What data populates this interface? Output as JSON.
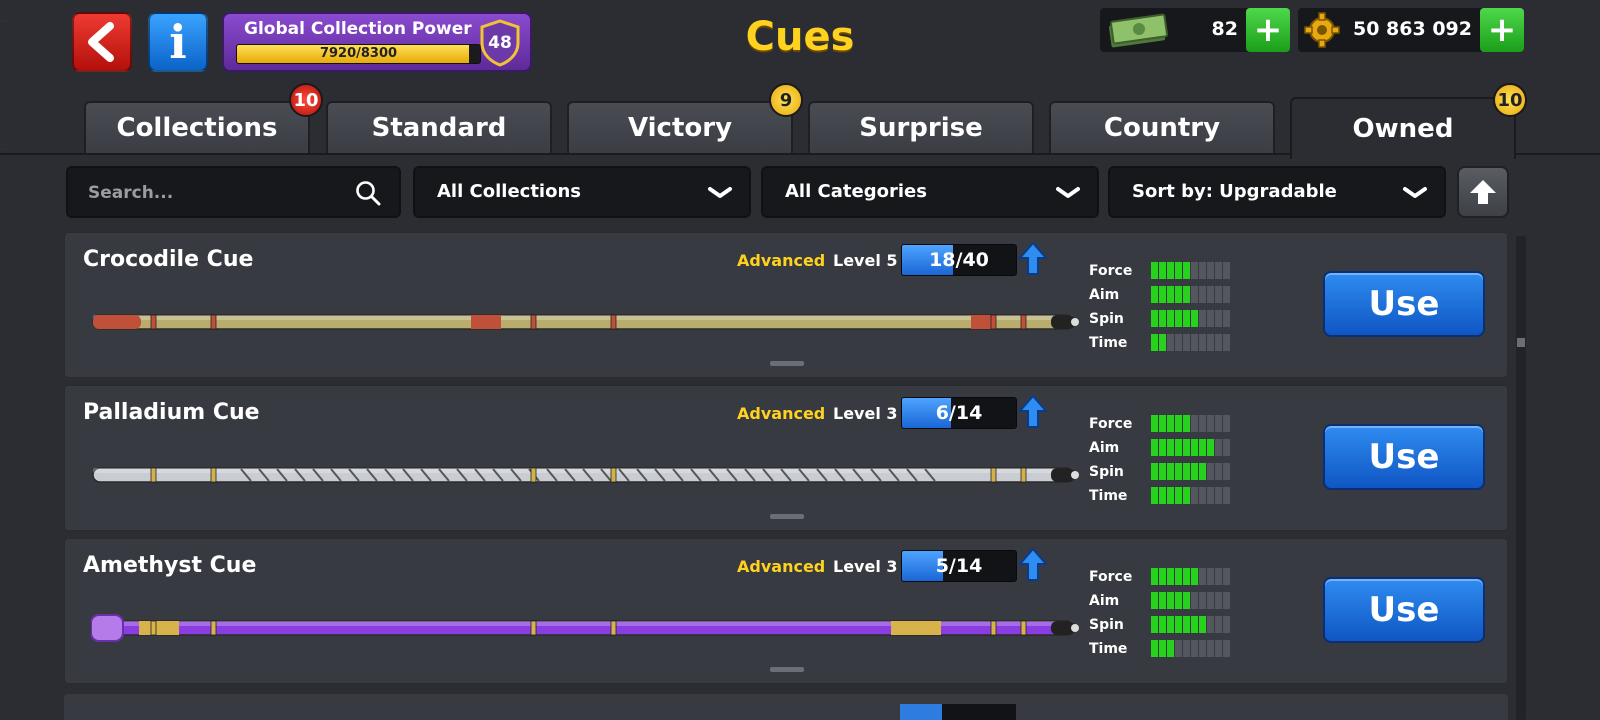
{
  "header": {
    "title": "Cues",
    "back_icon": "back-arrow-icon",
    "info_label": "i",
    "collection_power": {
      "label": "Global Collection Power",
      "current": 7920,
      "max": 8300,
      "text": "7920/8300",
      "level": "48"
    },
    "cash": {
      "value": "82",
      "icon": "cash-icon"
    },
    "coins": {
      "value": "50 863 092",
      "icon": "coin-icon"
    },
    "add_label": "+"
  },
  "tabs": [
    {
      "label": "Collections",
      "badge": "10",
      "badge_color": "red"
    },
    {
      "label": "Standard",
      "badge": ""
    },
    {
      "label": "Victory",
      "badge": "9",
      "badge_color": "yellow"
    },
    {
      "label": "Surprise",
      "badge": ""
    },
    {
      "label": "Country",
      "badge": ""
    },
    {
      "label": "Owned",
      "badge": "10",
      "badge_color": "yellow",
      "active": true
    }
  ],
  "filters": {
    "search_placeholder": "Search...",
    "collection": "All Collections",
    "category": "All Categories",
    "sort": "Sort by: Upgradable"
  },
  "stat_labels": [
    "Force",
    "Aim",
    "Spin",
    "Time"
  ],
  "cues": [
    {
      "name": "Crocodile Cue",
      "rarity": "Advanced",
      "level": "Level 5",
      "progress": {
        "current": 18,
        "max": 40,
        "text": "18/40"
      },
      "stats": {
        "force": 5,
        "aim": 5,
        "spin": 6,
        "time": 2
      },
      "action": "Use",
      "colors": {
        "shaft": "#b8ad6c",
        "accent": "#c0503a"
      }
    },
    {
      "name": "Palladium Cue",
      "rarity": "Advanced",
      "level": "Level 3",
      "progress": {
        "current": 6,
        "max": 14,
        "text": "6/14"
      },
      "stats": {
        "force": 5,
        "aim": 8,
        "spin": 7,
        "time": 5
      },
      "action": "Use",
      "colors": {
        "shaft": "#c9cdd3",
        "accent": "#d4b04a"
      }
    },
    {
      "name": "Amethyst Cue",
      "rarity": "Advanced",
      "level": "Level 3",
      "progress": {
        "current": 5,
        "max": 14,
        "text": "5/14"
      },
      "stats": {
        "force": 6,
        "aim": 5,
        "spin": 7,
        "time": 3
      },
      "action": "Use",
      "colors": {
        "shaft": "#8a3de0",
        "accent": "#d8b24a"
      }
    }
  ],
  "colors": {
    "accent_yellow": "#ffd21f",
    "stat_on": "#27d21c",
    "use_blue": "#1f72dc",
    "badge_red": "#d01a12"
  }
}
